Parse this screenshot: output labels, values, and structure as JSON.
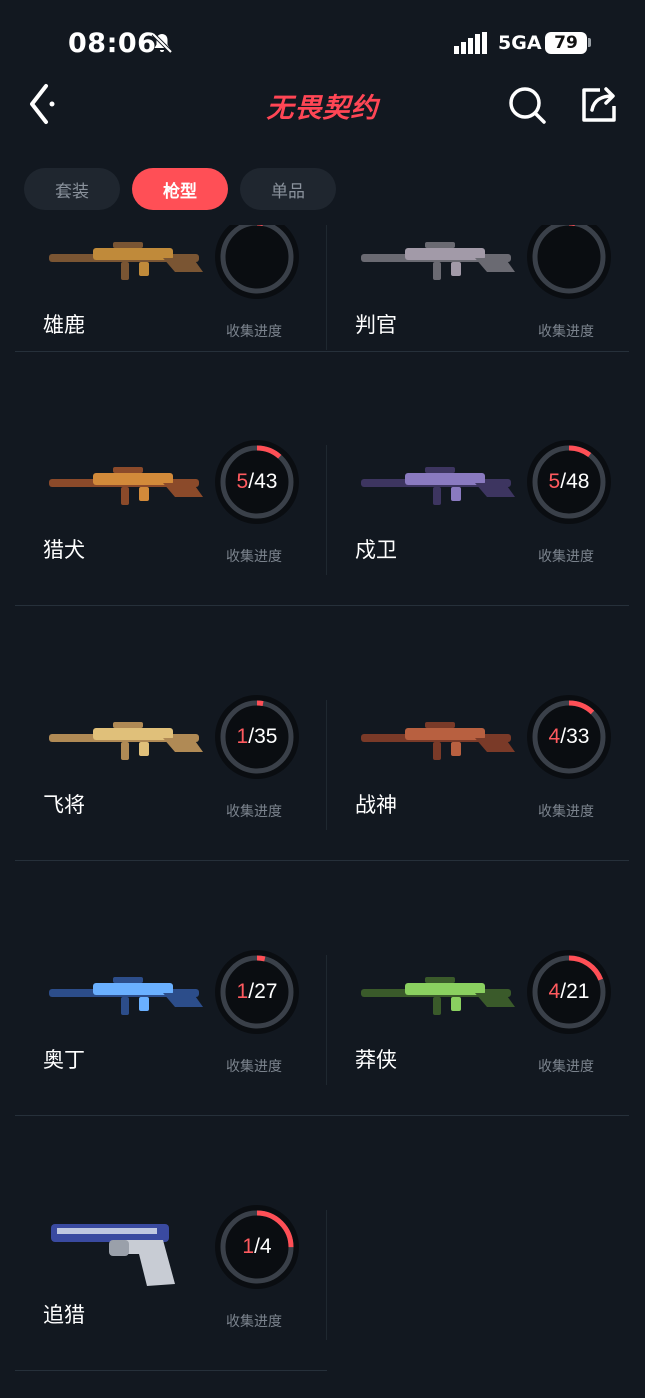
{
  "status_bar": {
    "time": "08:06",
    "network": "5GA",
    "battery": "79",
    "icons": [
      "bell-off-icon",
      "signal-icon"
    ]
  },
  "header": {
    "title": "无畏契约",
    "back_icon": "chevron-left-icon",
    "search_icon": "search-icon",
    "share_icon": "share-icon"
  },
  "tabs": [
    {
      "label": "套装",
      "active": false
    },
    {
      "label": "枪型",
      "active": true
    },
    {
      "label": "单品",
      "active": false
    }
  ],
  "progress_label": "收集进度",
  "colors": {
    "accent": "#ff4f56",
    "background": "#121820",
    "ring_track": "#3a4049"
  },
  "weapons": [
    {
      "name": "雄鹿",
      "collected": null,
      "total": null,
      "image": "rifle-icon"
    },
    {
      "name": "判官",
      "collected": null,
      "total": null,
      "image": "rifle-icon"
    },
    {
      "name": "猎犬",
      "collected": 5,
      "total": 43,
      "image": "rifle-icon"
    },
    {
      "name": "戍卫",
      "collected": 5,
      "total": 48,
      "image": "rifle-icon"
    },
    {
      "name": "飞将",
      "collected": 1,
      "total": 35,
      "image": "rifle-icon"
    },
    {
      "name": "战神",
      "collected": 4,
      "total": 33,
      "image": "rifle-icon"
    },
    {
      "name": "奥丁",
      "collected": 1,
      "total": 27,
      "image": "rifle-icon"
    },
    {
      "name": "莽侠",
      "collected": 4,
      "total": 21,
      "image": "rifle-icon"
    },
    {
      "name": "追猎",
      "collected": 1,
      "total": 4,
      "image": "pistol-icon"
    }
  ]
}
